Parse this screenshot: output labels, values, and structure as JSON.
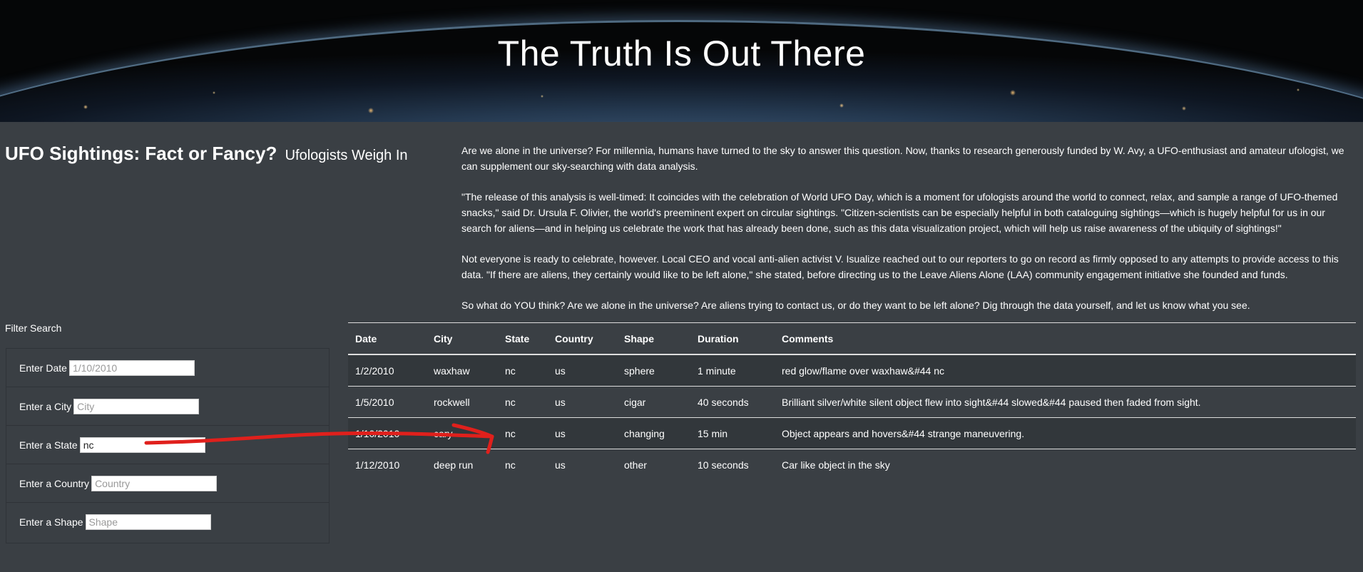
{
  "hero": {
    "title": "The Truth Is Out There"
  },
  "headline": {
    "title": "UFO Sightings: Fact or Fancy?",
    "subtitle": "Ufologists Weigh In"
  },
  "article": {
    "paragraphs": [
      "Are we alone in the universe? For millennia, humans have turned to the sky to answer this question. Now, thanks to research generously funded by W. Avy, a UFO-enthusiast and amateur ufologist, we can supplement our sky-searching with data analysis.",
      "\"The release of this analysis is well-timed: It coincides with the celebration of World UFO Day, which is a moment for ufologists around the world to connect, relax, and sample a range of UFO-themed snacks,\" said Dr. Ursula F. Olivier, the world's preeminent expert on circular sightings. \"Citizen-scientists can be especially helpful in both cataloguing sightings—which is hugely helpful for us in our search for aliens—and in helping us celebrate the work that has already been done, such as this data visualization project, which will help us raise awareness of the ubiquity of sightings!\"",
      "Not everyone is ready to celebrate, however. Local CEO and vocal anti-alien activist V. Isualize reached out to our reporters to go on record as firmly opposed to any attempts to provide access to this data. \"If there are aliens, they certainly would like to be left alone,\" she stated, before directing us to the Leave Aliens Alone (LAA) community engagement initiative she founded and funds.",
      "So what do YOU think? Are we alone in the universe? Are aliens trying to contact us, or do they want to be left alone? Dig through the data yourself, and let us know what you see."
    ]
  },
  "filters": {
    "title": "Filter Search",
    "items": [
      {
        "label": "Enter Date",
        "placeholder": "1/10/2010",
        "value": ""
      },
      {
        "label": "Enter a City",
        "placeholder": "City",
        "value": ""
      },
      {
        "label": "Enter a State",
        "placeholder": "State",
        "value": "nc"
      },
      {
        "label": "Enter a Country",
        "placeholder": "Country",
        "value": ""
      },
      {
        "label": "Enter a Shape",
        "placeholder": "Shape",
        "value": ""
      }
    ]
  },
  "table": {
    "headers": [
      "Date",
      "City",
      "State",
      "Country",
      "Shape",
      "Duration",
      "Comments"
    ],
    "rows": [
      [
        "1/2/2010",
        "waxhaw",
        "nc",
        "us",
        "sphere",
        "1 minute",
        "red glow/flame over waxhaw&#44 nc"
      ],
      [
        "1/5/2010",
        "rockwell",
        "nc",
        "us",
        "cigar",
        "40 seconds",
        "Brilliant silver/white silent object flew into sight&#44 slowed&#44 paused then faded from sight."
      ],
      [
        "1/10/2010",
        "cary",
        "nc",
        "us",
        "changing",
        "15 min",
        "Object appears and hovers&#44 strange maneuvering."
      ],
      [
        "1/12/2010",
        "deep run",
        "nc",
        "us",
        "other",
        "10 seconds",
        "Car like object in the sky"
      ]
    ]
  },
  "annotation": {
    "color": "#e0201c"
  }
}
